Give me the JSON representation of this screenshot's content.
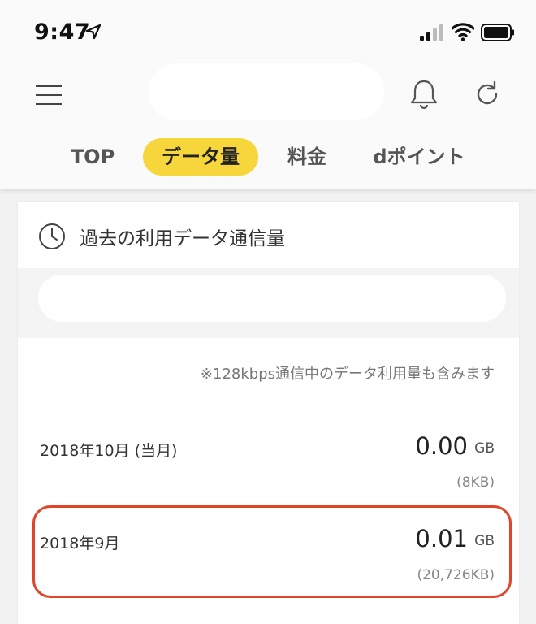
{
  "status_bar": {
    "time": "9:47",
    "icons": [
      "location-arrow-icon",
      "cellular-signal-icon",
      "wifi-icon",
      "battery-icon"
    ]
  },
  "header": {
    "icons": [
      "menu-icon",
      "bell-icon",
      "refresh-icon"
    ],
    "tabs": [
      {
        "label": "TOP",
        "active": false
      },
      {
        "label": "データ量",
        "active": true
      },
      {
        "label": "料金",
        "active": false
      },
      {
        "label": "dポイント",
        "active": false
      }
    ]
  },
  "card": {
    "icon": "clock-icon",
    "title": "過去の利用データ通信量",
    "note": "※128kbps通信中のデータ利用量も含みます",
    "rows": [
      {
        "month": "2018年10月 (当月)",
        "value": "0.00",
        "unit": "GB",
        "kb": "(8KB)",
        "highlighted": false
      },
      {
        "month": "2018年9月",
        "value": "0.01",
        "unit": "GB",
        "kb": "(20,726KB)",
        "highlighted": true
      }
    ]
  },
  "colors": {
    "active_tab": "#f7d63b",
    "highlight_outline": "#e0452b",
    "background": "#f2f2f2"
  }
}
